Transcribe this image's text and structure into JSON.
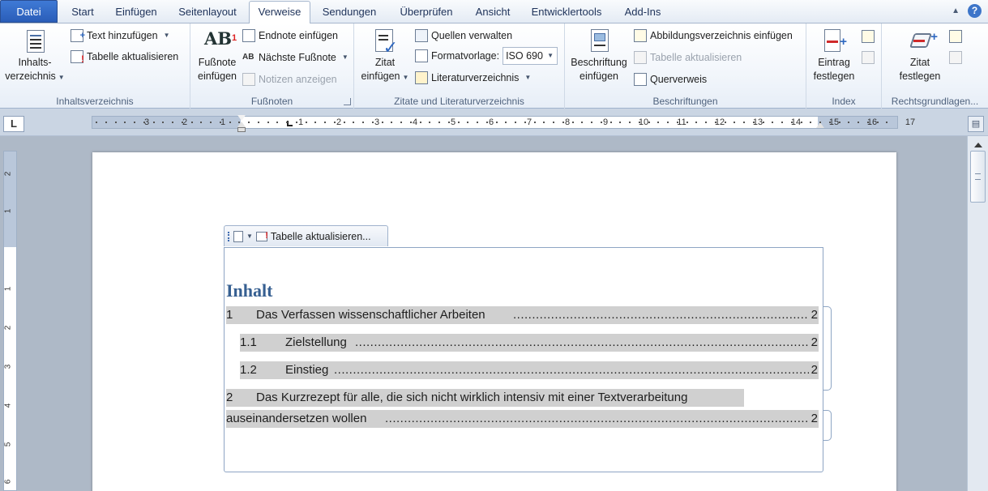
{
  "tabs": [
    {
      "label": "Datei"
    },
    {
      "label": "Start"
    },
    {
      "label": "Einfügen"
    },
    {
      "label": "Seitenlayout"
    },
    {
      "label": "Verweise"
    },
    {
      "label": "Sendungen"
    },
    {
      "label": "Überprüfen"
    },
    {
      "label": "Ansicht"
    },
    {
      "label": "Entwicklertools"
    },
    {
      "label": "Add-Ins"
    }
  ],
  "help_glyph": "?",
  "ribbon": {
    "toc_group": {
      "label": "Inhaltsverzeichnis",
      "big_button_line1": "Inhalts-",
      "big_button_line2": "verzeichnis",
      "add_text": "Text hinzufügen",
      "update_table": "Tabelle aktualisieren"
    },
    "footnotes_group": {
      "label": "Fußnoten",
      "insert_footnote_line1": "Fußnote",
      "insert_footnote_line2": "einfügen",
      "ab_glyph": "AB",
      "ab_sup": "1",
      "insert_endnote": "Endnote einfügen",
      "next_footnote": "Nächste Fußnote",
      "show_notes": "Notizen anzeigen"
    },
    "citations_group": {
      "label": "Zitate und Literaturverzeichnis",
      "insert_citation_line1": "Zitat",
      "insert_citation_line2": "einfügen",
      "manage_sources": "Quellen verwalten",
      "style_label": "Formatvorlage:",
      "style_value": "ISO 690",
      "bibliography": "Literaturverzeichnis"
    },
    "captions_group": {
      "label": "Beschriftungen",
      "insert_caption_line1": "Beschriftung",
      "insert_caption_line2": "einfügen",
      "insert_table_of_figures": "Abbildungsverzeichnis einfügen",
      "update_table": "Tabelle aktualisieren",
      "cross_reference": "Querverweis"
    },
    "index_group": {
      "label": "Index",
      "mark_entry_line1": "Eintrag",
      "mark_entry_line2": "festlegen"
    },
    "authorities_group": {
      "label": "Rechtsgrundlagen...",
      "mark_citation_line1": "Zitat",
      "mark_citation_line2": "festlegen"
    }
  },
  "ruler": {
    "left_numbers": [
      "3",
      "2",
      "1"
    ],
    "right_numbers": [
      "1",
      "2",
      "3",
      "4",
      "5",
      "6",
      "7",
      "8",
      "9",
      "10",
      "11",
      "12",
      "13",
      "14",
      "15",
      "16",
      "17"
    ],
    "tab_selector_glyph": "L"
  },
  "vruler_numbers": [
    "2",
    "1",
    "1",
    "2",
    "3",
    "4",
    "5",
    "6"
  ],
  "document": {
    "toc_handle_label": "Tabelle aktualisieren...",
    "toc_title": "Inhalt",
    "entries": [
      {
        "num": "1",
        "text": "Das Verfassen wissenschaftlicher Arbeiten",
        "page": "2"
      },
      {
        "num": "1.1",
        "text": "Zielstellung",
        "page": "2"
      },
      {
        "num": "1.2",
        "text": "Einstieg",
        "page": "2"
      },
      {
        "num": "2",
        "text": "Das Kurzrezept für alle, die sich nicht wirklich intensiv mit einer Textverarbeitung",
        "text_cont": "auseinandersetzen wollen",
        "page": "2"
      }
    ],
    "leader": "....................................................................................................................................................................................................................."
  }
}
